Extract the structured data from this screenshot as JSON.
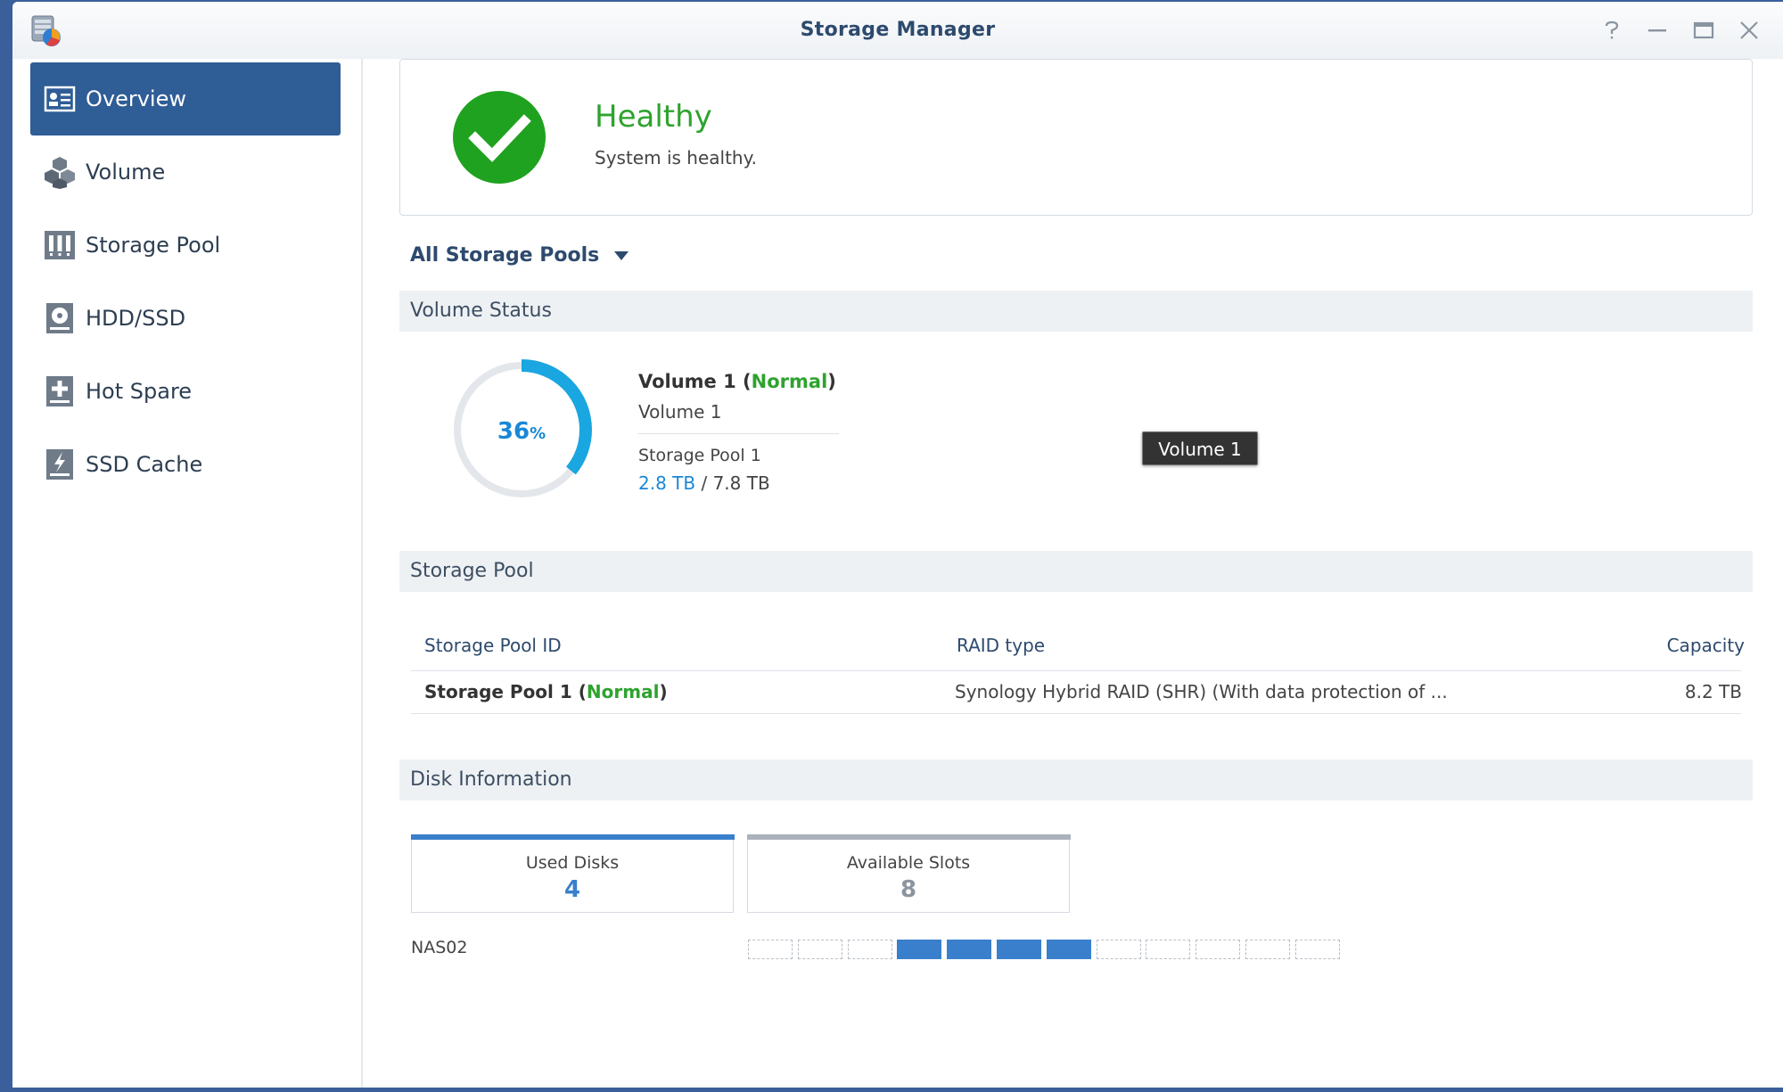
{
  "window": {
    "title": "Storage Manager"
  },
  "sidebar": {
    "items": [
      {
        "label": "Overview",
        "icon": "overview-icon",
        "active": true
      },
      {
        "label": "Volume",
        "icon": "volume-cubes-icon",
        "active": false
      },
      {
        "label": "Storage Pool",
        "icon": "storage-pool-icon",
        "active": false
      },
      {
        "label": "HDD/SSD",
        "icon": "hdd-icon",
        "active": false
      },
      {
        "label": "Hot Spare",
        "icon": "hot-spare-plus-icon",
        "active": false
      },
      {
        "label": "SSD Cache",
        "icon": "ssd-cache-bolt-icon",
        "active": false
      }
    ]
  },
  "health": {
    "title": "Healthy",
    "subtitle": "System is healthy.",
    "color": "#2ea32e"
  },
  "pool_filter": {
    "label": "All Storage Pools"
  },
  "volume_status": {
    "header": "Volume Status",
    "usage_percent": 36,
    "usage_number": "36",
    "usage_unit": "%",
    "name": "Volume 1",
    "status": "Normal",
    "description": "Volume 1",
    "pool": "Storage Pool 1",
    "used": "2.8 TB",
    "capacity_sep": " / ",
    "total": "7.8 TB",
    "tooltip": "Volume 1"
  },
  "storage_pool": {
    "header": "Storage Pool",
    "columns": [
      "Storage Pool ID",
      "RAID type",
      "Capacity"
    ],
    "rows": [
      {
        "id": "Storage Pool 1",
        "status": "Normal",
        "raid": "Synology Hybrid RAID (SHR) (With data protection of ...",
        "capacity": "8.2 TB"
      }
    ]
  },
  "disk_info": {
    "header": "Disk Information",
    "used_label": "Used Disks",
    "used_count": "4",
    "available_label": "Available Slots",
    "available_count": "8",
    "nas_name": "NAS02",
    "slots": [
      false,
      false,
      false,
      true,
      true,
      true,
      true,
      false,
      false,
      false,
      false,
      false
    ]
  },
  "colors": {
    "accent": "#2f5d96",
    "normal": "#2ea32e",
    "link": "#1a87d6",
    "used_slot": "#3a7fcc"
  }
}
